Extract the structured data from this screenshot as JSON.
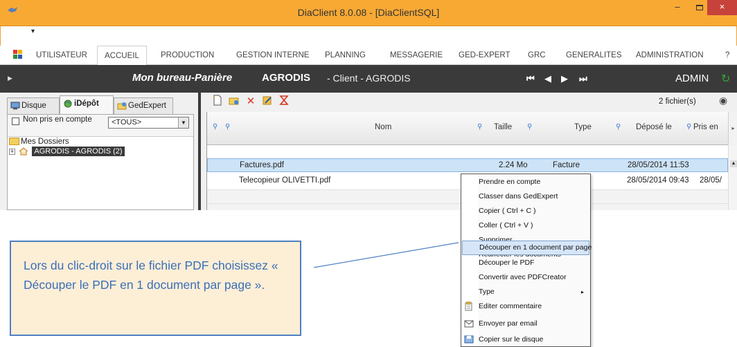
{
  "window": {
    "title": "DiaClient 8.0.08 - [DiaClientSQL]",
    "controls": {
      "minimize": "–",
      "close": "×"
    }
  },
  "quick_access": {
    "arrow": "▾"
  },
  "menubar": {
    "items": [
      {
        "label": "UTILISATEUR"
      },
      {
        "label": "ACCUEIL"
      },
      {
        "label": "PRODUCTION"
      },
      {
        "label": "GESTION INTERNE"
      },
      {
        "label": "PLANNING"
      },
      {
        "label": "MESSAGERIE"
      },
      {
        "label": "GED-EXPERT"
      },
      {
        "label": "GRC"
      },
      {
        "label": "GENERALITES"
      },
      {
        "label": "ADMINISTRATION"
      },
      {
        "label": "?"
      }
    ],
    "active": "ACCUEIL"
  },
  "header": {
    "bureau": "Mon bureau-Panière",
    "client_name": "AGRODIS",
    "client_sub": "- Client - AGRODIS",
    "nav": [
      "⏮",
      "◀",
      "▶",
      "⏭"
    ],
    "user": "ADMIN"
  },
  "left_panel": {
    "tabs": [
      {
        "label": "Disque"
      },
      {
        "label": "iDépôt"
      },
      {
        "label": "GedExpert"
      }
    ],
    "active_tab": "iDépôt",
    "filter_label": "Non pris en compte",
    "filter_checked": false,
    "filter_combo": "<TOUS>",
    "tree_root": "Mes Dossiers",
    "tree_node": "AGRODIS - AGRODIS  (2)",
    "tree_expander": "+"
  },
  "right_panel": {
    "file_count": "2 fichier(s)",
    "columns": [
      "Nom",
      "Taille",
      "Type",
      "Déposé le",
      "Pris en"
    ],
    "rows": [
      {
        "nom": "Factures.pdf",
        "taille": "2.24 Mo",
        "type": "Facture",
        "depose": "28/05/2014 11:53",
        "pris": ""
      },
      {
        "nom": "Telecopieur OLIVETTI.pdf",
        "taille": "",
        "type": "",
        "depose": "28/05/2014 09:43",
        "pris": "28/05/"
      }
    ],
    "selected_row": 0
  },
  "context_menu": {
    "items": [
      {
        "label": "Prendre en compte"
      },
      {
        "label": "Classer dans GedExpert"
      },
      {
        "label": "Copier ( Ctrl + C )"
      },
      {
        "label": "Coller ( Ctrl + V )"
      },
      {
        "label": "Supprimer"
      },
      {
        "label": "Réaffecter les documents"
      },
      {
        "label": "Découper en 1 document par page"
      },
      {
        "label": "Découper le PDF"
      },
      {
        "label": "Convertir avec PDFCreator"
      },
      {
        "label": "Type",
        "submenu": true
      },
      {
        "label": "Editer commentaire",
        "icon": "clipboard-icon"
      },
      {
        "label": "Envoyer par email",
        "icon": "email-icon"
      },
      {
        "label": "Copier sur le disque",
        "icon": "disk-copy-icon"
      }
    ],
    "highlighted": "Découper en 1 document par page",
    "submenu_arrow": "▸"
  },
  "callout": {
    "text": "Lors du clic-droit sur le fichier PDF choisissez « Découper le PDF en 1 document par page »."
  },
  "colors": {
    "titlebar": "#f7a934",
    "close": "#c7423b",
    "dark_header": "#3a3a3a",
    "callout_bg": "#fdeed6",
    "callout_text": "#3a6fb8",
    "selection": "#cde3f7"
  }
}
